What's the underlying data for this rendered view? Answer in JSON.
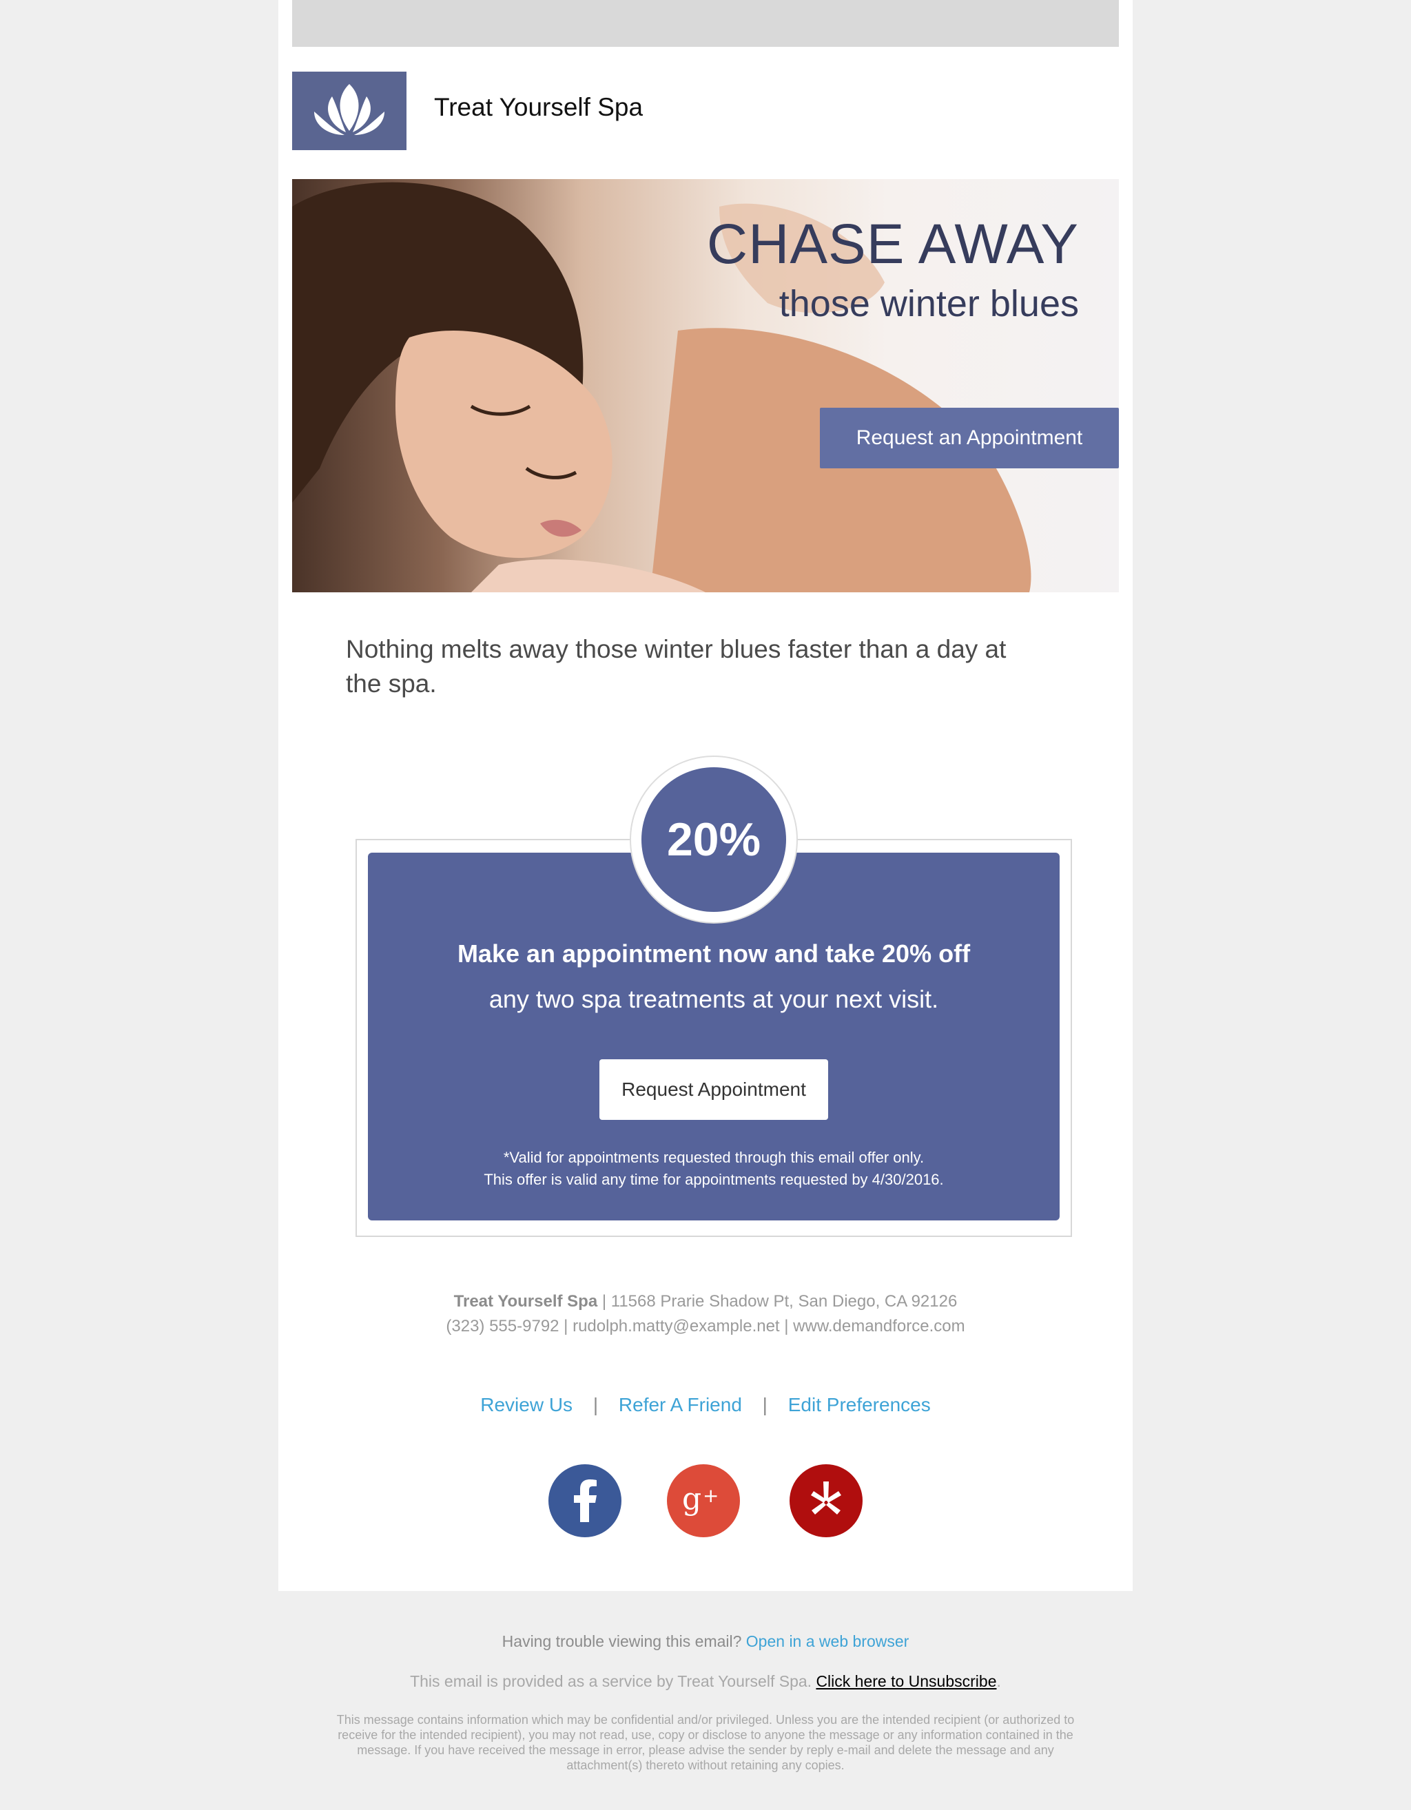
{
  "brand": {
    "name": "Treat Yourself Spa",
    "logo_icon": "lotus-icon",
    "accent": "#5a6591"
  },
  "hero": {
    "headline": "CHASE AWAY",
    "subheadline": "those winter blues",
    "cta_label": "Request an Appointment"
  },
  "intro": "Nothing melts away those winter blues faster than a day at the spa.",
  "offer": {
    "badge": "20%",
    "line1": "Make an appointment now and take 20% off",
    "line2": "any two spa treatments at your next visit.",
    "button_label": "Request Appointment",
    "fine_print_1": "*Valid for appointments requested through this email offer only.",
    "fine_print_2": "This offer is valid any time for appointments requested by 4/30/2016."
  },
  "contact": {
    "business": "Treat Yourself Spa",
    "address": "| 11568 Prarie Shadow Pt, San Diego, CA 92126",
    "line2": "(323) 555-9792 | rudolph.matty@example.net | www.demandforce.com"
  },
  "links": {
    "review": "Review Us",
    "refer": "Refer A Friend",
    "prefs": "Edit Preferences",
    "separator": "|"
  },
  "social": [
    {
      "name": "facebook-icon",
      "color": "#3b5998"
    },
    {
      "name": "google-plus-icon",
      "color": "#dd4b39"
    },
    {
      "name": "yelp-icon",
      "color": "#b00e0e"
    }
  ],
  "footer": {
    "trouble_text": "Having trouble viewing this email?",
    "open_link": "Open in a web browser",
    "service_text": "This email is provided as a service by Treat Yourself Spa.",
    "unsubscribe": "Click here to Unsubscribe",
    "period": ".",
    "legal": "This message contains information which may be confidential and/or privileged. Unless you are the intended recipient (or authorized to receive for the intended recipient), you may not read, use, copy or disclose to anyone the message or any information contained in the message. If you have received the message in error, please advise the sender by reply e-mail and delete the message and any attachment(s) thereto without retaining any copies."
  }
}
